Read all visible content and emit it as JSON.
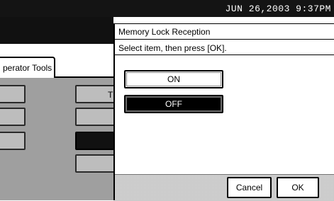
{
  "status_bar": {
    "datetime": "JUN  26,2003  9:37PM"
  },
  "background": {
    "tab_label": "perator Tools",
    "partial_button_letter": "T"
  },
  "dialog": {
    "title": "Memory Lock Reception",
    "instruction": "Select item, then press [OK].",
    "options": [
      {
        "label": "ON",
        "selected": false
      },
      {
        "label": "OFF",
        "selected": true
      }
    ],
    "cancel_label": "Cancel",
    "ok_label": "OK"
  }
}
